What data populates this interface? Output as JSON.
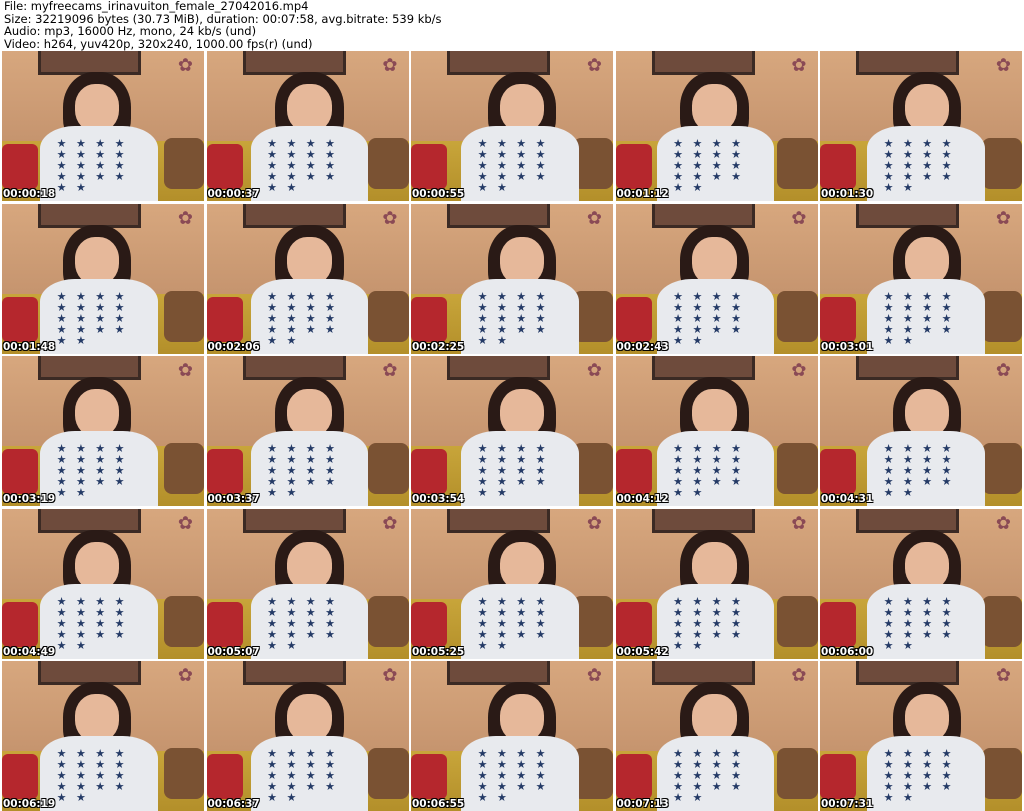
{
  "header": {
    "file": "File: myfreecams_irinavuiton_female_27042016.mp4",
    "size": "Size: 32219096 bytes (30.73 MiB), duration: 00:07:58, avg.bitrate: 539 kb/s",
    "audio": "Audio: mp3, 16000 Hz, mono, 24 kb/s (und)",
    "video": "Video: h264, yuv420p, 320x240, 1000.00 fps(r) (und)"
  },
  "thumbnails": [
    "00:00:18",
    "00:00:37",
    "00:00:55",
    "00:01:12",
    "00:01:30",
    "00:01:48",
    "00:02:06",
    "00:02:25",
    "00:02:43",
    "00:03:01",
    "00:03:19",
    "00:03:37",
    "00:03:54",
    "00:04:12",
    "00:04:31",
    "00:04:49",
    "00:05:07",
    "00:05:25",
    "00:05:42",
    "00:06:00",
    "00:06:19",
    "00:06:37",
    "00:06:55",
    "00:07:13",
    "00:07:31"
  ],
  "icons": {
    "flower": "flower-icon",
    "star": "star-icon"
  },
  "colors": {
    "timestamp_text": "#ffffff",
    "shirt_stars": "#243a66",
    "sofa": "#c8a53a"
  }
}
